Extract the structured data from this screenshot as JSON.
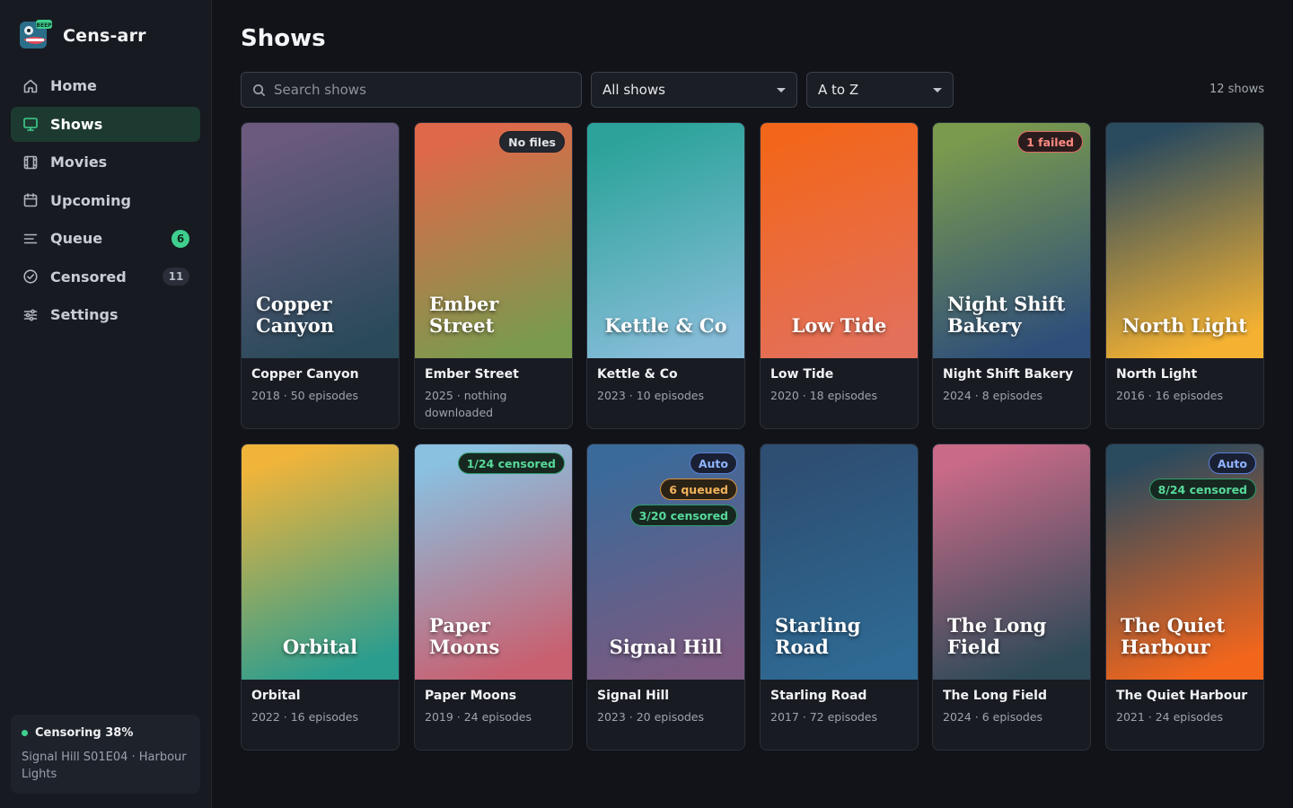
{
  "app": {
    "name": "Cens-arr",
    "logo_badge": "BEEP"
  },
  "sidebar": {
    "items": [
      {
        "label": "Home",
        "icon": "home-icon",
        "active": false
      },
      {
        "label": "Shows",
        "icon": "tv-icon",
        "active": true
      },
      {
        "label": "Movies",
        "icon": "film-icon",
        "active": false
      },
      {
        "label": "Upcoming",
        "icon": "calendar-icon",
        "active": false
      },
      {
        "label": "Queue",
        "icon": "queue-icon",
        "active": false,
        "count": "6"
      },
      {
        "label": "Censored",
        "icon": "check-circle-icon",
        "active": false,
        "count": "11"
      },
      {
        "label": "Settings",
        "icon": "sliders-icon",
        "active": false
      }
    ],
    "status": {
      "title": "Censoring 38%",
      "detail": "Signal Hill S01E04 · Harbour Lights"
    }
  },
  "page": {
    "title": "Shows",
    "search_placeholder": "Search shows",
    "filter_value": "All shows",
    "sort_value": "A to Z",
    "count": "12 shows"
  },
  "shows": [
    {
      "title": "Copper Canyon",
      "meta": "2018 · 50 episodes",
      "badges": []
    },
    {
      "title": "Ember Street",
      "meta": "2025 · nothing downloaded",
      "badges": [
        {
          "text": "No files",
          "kind": "neutral"
        }
      ]
    },
    {
      "title": "Kettle & Co",
      "meta": "2023 · 10 episodes",
      "badges": []
    },
    {
      "title": "Low Tide",
      "meta": "2020 · 18 episodes",
      "badges": []
    },
    {
      "title": "Night Shift Bakery",
      "meta": "2024 · 8 episodes",
      "badges": [
        {
          "text": "1 failed",
          "kind": "failed"
        }
      ]
    },
    {
      "title": "North Light",
      "meta": "2016 · 16 episodes",
      "badges": []
    },
    {
      "title": "Orbital",
      "meta": "2022 · 16 episodes",
      "badges": []
    },
    {
      "title": "Paper Moons",
      "meta": "2019 · 24 episodes",
      "badges": [
        {
          "text": "1/24 censored",
          "kind": "censored"
        }
      ]
    },
    {
      "title": "Signal Hill",
      "meta": "2023 · 20 episodes",
      "badges": [
        {
          "text": "Auto",
          "kind": "auto"
        },
        {
          "text": "6 queued",
          "kind": "queued"
        },
        {
          "text": "3/20 censored",
          "kind": "censored"
        }
      ]
    },
    {
      "title": "Starling Road",
      "meta": "2017 · 72 episodes",
      "badges": []
    },
    {
      "title": "The Long Field",
      "meta": "2024 · 6 episodes",
      "badges": []
    },
    {
      "title": "The Quiet Harbour",
      "meta": "2021 · 24 episodes",
      "badges": [
        {
          "text": "Auto",
          "kind": "auto"
        },
        {
          "text": "8/24 censored",
          "kind": "censored"
        }
      ]
    }
  ],
  "poster_colors": [
    [
      "#6b5a7e",
      "#2a4a5a"
    ],
    [
      "#e0684a",
      "#7a9a4e"
    ],
    [
      "#2ba39a",
      "#86bcd8"
    ],
    [
      "#f2661c",
      "#e3705a"
    ],
    [
      "#7a9a4e",
      "#2f4f7a"
    ],
    [
      "#2a4a5e",
      "#f5b232"
    ],
    [
      "#f0b43a",
      "#2a9d8f"
    ],
    [
      "#8ac0e0",
      "#c86070"
    ],
    [
      "#3a6a9a",
      "#7a5a80"
    ],
    [
      "#2e4e72",
      "#2e6a94"
    ],
    [
      "#c86a88",
      "#2e4a58"
    ],
    [
      "#2a4a5e",
      "#f2661c"
    ]
  ]
}
